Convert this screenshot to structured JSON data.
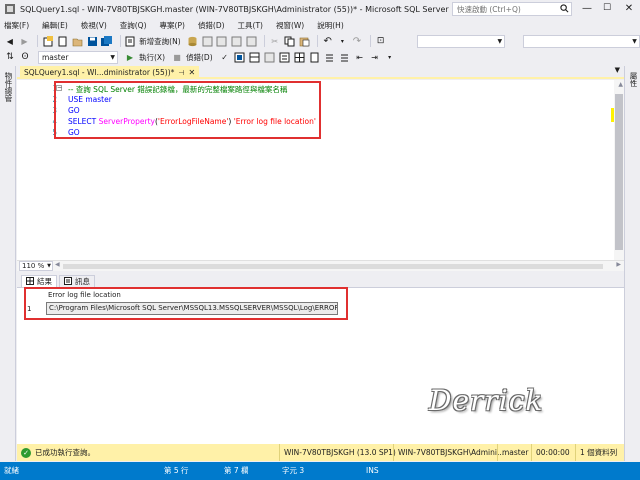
{
  "window": {
    "title": "SQLQuery1.sql - WIN-7V80TBJSKGH.master (WIN-7V80TBJSKGH\\Administrator (55))* - Microsoft SQL Server Manage...",
    "quick_launch_placeholder": "快速啟動 (Ctrl+Q)",
    "min": "—",
    "max": "☐",
    "close": "✕"
  },
  "menu": [
    "檔案(F)",
    "編輯(E)",
    "檢視(V)",
    "查詢(Q)",
    "專案(P)",
    "偵錯(D)",
    "工具(T)",
    "視窗(W)",
    "說明(H)"
  ],
  "toolbar": {
    "new_query_label": "新增查詢(N)",
    "database": "master",
    "execute_label": "執行(X)",
    "debug_label": "偵錯(D)"
  },
  "side": {
    "left_panel": "物件總管",
    "right_panel": "屬性"
  },
  "tab": {
    "title": "SQLQuery1.sql - WI...dministrator (55))*",
    "pin": "⊣",
    "close": "✕"
  },
  "editor": {
    "line_numbers": [
      "1",
      "2",
      "3",
      "4",
      "5"
    ],
    "comment": "-- 查詢 SQL Server 錯誤記錄檔，最新的完整檔案路徑與檔案名稱",
    "line2": "USE master",
    "line3": "GO",
    "line4_select": "SELECT",
    "line4_fn": "ServerProperty",
    "line4_open": "(",
    "line4_arg": "'ErrorLogFileName'",
    "line4_close": ")",
    "line4_alias": "'Error log file location'",
    "line5": "GO"
  },
  "zoom": "110 %",
  "results": {
    "tabs": [
      "結果",
      "訊息"
    ],
    "column_header": "Error log file location",
    "row_number": "1",
    "cell_value": "C:\\Program Files\\Microsoft SQL Server\\MSSQL13.MSSQLSERVER\\MSSQL\\Log\\ERRORLOG"
  },
  "watermark": "Derrick",
  "query_status": {
    "message": "已成功執行查詢。",
    "server": "WIN-7V80TBJSKGH (13.0 SP1)",
    "user": "WIN-7V80TBJSKGH\\Admini...",
    "database": "master",
    "elapsed": "00:00:00",
    "rows": "1 個資料列"
  },
  "statusbar": {
    "ready": "就緒",
    "line": "第 5 行",
    "col": "第 7 欄",
    "char": "字元 3",
    "mode": "INS"
  },
  "colors": {
    "accent": "#007acc",
    "tab_active": "#fff1a8",
    "highlight_box": "#e03030"
  }
}
